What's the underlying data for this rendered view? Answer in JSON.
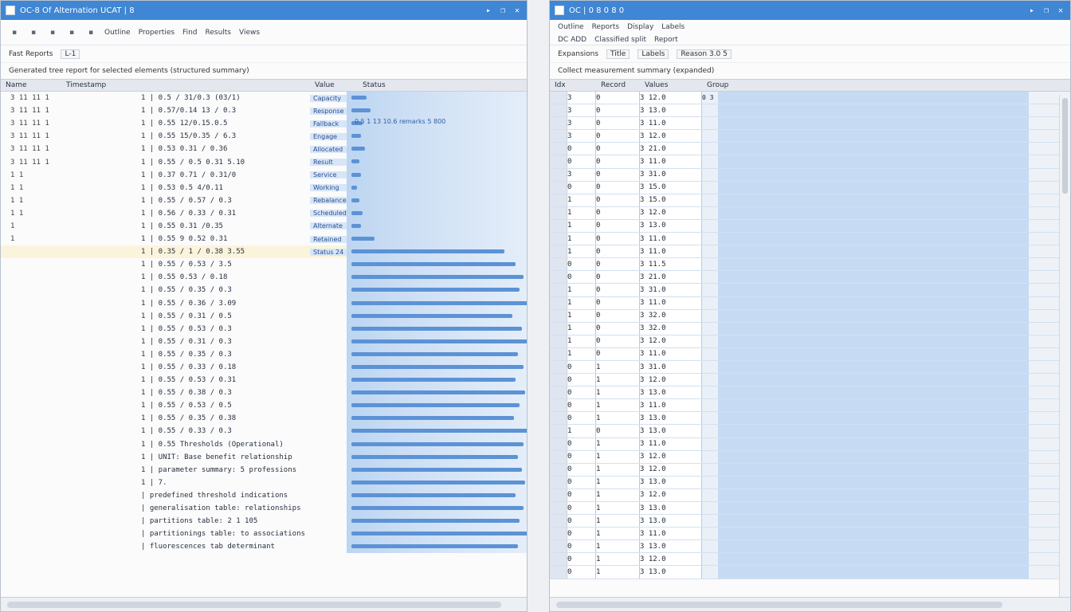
{
  "left": {
    "title": "OC-8 Of Alternation UCAT | 8",
    "toolbar": {
      "items": [
        "Outline",
        "Properties",
        "Find",
        "Results",
        "Views"
      ]
    },
    "path": {
      "label": "Fast Reports",
      "chip": "L-1"
    },
    "status": "Generated tree report for selected elements (structured summary)",
    "headers": [
      "Name",
      "Timestamp",
      "Value",
      "Status"
    ],
    "rows": [
      {
        "a": "3 11 11 1",
        "b": "1 | 0.5 / 31/0.3 (03/1)",
        "c": "Capacity",
        "v": 0.08
      },
      {
        "a": "3 11 11 1",
        "b": "1 | 0.57/0.14 13 / 0.3",
        "c": "Response",
        "v": 0.1
      },
      {
        "a": "3 11 11 1",
        "b": "1 | 0.55 12/0.15.0.5",
        "c": "Fallback",
        "v": 0.06,
        "l": "0.5 1 13 10.6 remarks 5 800"
      },
      {
        "a": "3 11 11 1",
        "b": "1 | 0.55 15/0.35 / 6.3",
        "c": "Engage",
        "v": 0.05
      },
      {
        "a": "3 11 11 1",
        "b": "1 | 0.53 0.31 / 0.36",
        "c": "Allocated",
        "v": 0.07
      },
      {
        "a": "3 11 11 1",
        "b": "1 | 0.55 / 0.5 0.31 5.10",
        "c": "Result",
        "v": 0.04
      },
      {
        "a": "1 1",
        "b": "1 | 0.37 0.71 / 0.31/0",
        "c": "Service",
        "v": 0.05
      },
      {
        "a": "1 1",
        "b": "1 | 0.53 0.5 4/0.11",
        "c": "Working",
        "v": 0.03
      },
      {
        "a": "1 1",
        "b": "1 | 0.55 / 0.57 / 0.3",
        "c": "Rebalance",
        "v": 0.04
      },
      {
        "a": "1 1",
        "b": "1 | 0.56 / 0.33 / 0.31",
        "c": "Scheduled",
        "v": 0.06
      },
      {
        "a": "1",
        "b": "1 | 0.55 0.31 /0.35",
        "c": "Alternate",
        "v": 0.05
      },
      {
        "a": "1",
        "b": "1 | 0.55 9 0.52 0.31",
        "c": "Retained",
        "v": 0.12
      },
      {
        "a": "",
        "b": "1 | 0.35 / 1 / 0.38 3.55",
        "c": "Status 24",
        "v": 0.8,
        "sel": true
      },
      {
        "a": "",
        "b": "1 | 0.55 / 0.53 / 3.5",
        "c": "",
        "v": 0.86
      },
      {
        "a": "",
        "b": "1 | 0.55 0.53 / 0.18",
        "c": "",
        "v": 0.9
      },
      {
        "a": "",
        "b": "1 | 0.55 / 0.35 / 0.3",
        "c": "",
        "v": 0.88
      },
      {
        "a": "",
        "b": "1 | 0.55 / 0.36 / 3.09",
        "c": "",
        "v": 0.92
      },
      {
        "a": "",
        "b": "1 | 0.55 / 0.31 / 0.5",
        "c": "",
        "v": 0.84
      },
      {
        "a": "",
        "b": "1 | 0.55 / 0.53 / 0.3",
        "c": "",
        "v": 0.89
      },
      {
        "a": "",
        "b": "1 | 0.55 / 0.31 / 0.3",
        "c": "",
        "v": 0.93
      },
      {
        "a": "",
        "b": "1 | 0.55 / 0.35 / 0.3",
        "c": "",
        "v": 0.87
      },
      {
        "a": "",
        "b": "1 | 0.55 / 0.33 / 0.18",
        "c": "",
        "v": 0.9
      },
      {
        "a": "",
        "b": "1 | 0.55 / 0.53 / 0.31",
        "c": "",
        "v": 0.86
      },
      {
        "a": "",
        "b": "1 | 0.55 / 0.38 / 0.3",
        "c": "",
        "v": 0.91
      },
      {
        "a": "",
        "b": "1 | 0.55 / 0.53 / 0.5",
        "c": "",
        "v": 0.88
      },
      {
        "a": "",
        "b": "1 | 0.55 / 0.35 / 0.38",
        "c": "",
        "v": 0.85
      },
      {
        "a": "",
        "b": "1 | 0.55 / 0.33 / 0.3",
        "c": "",
        "v": 0.92
      },
      {
        "a": "",
        "b": "1 | 0.55 Thresholds (Operational)",
        "c": "",
        "v": 0.9
      },
      {
        "a": "",
        "b": "1 | UNIT: Base benefit relationship",
        "c": "",
        "v": 0.87
      },
      {
        "a": "",
        "b": "1 | parameter summary: 5 professions",
        "c": "",
        "v": 0.89
      },
      {
        "a": "",
        "b": "1 | 7.",
        "c": "",
        "v": 0.91
      },
      {
        "a": "",
        "b": "| predefined threshold indications",
        "c": "",
        "v": 0.86
      },
      {
        "a": "",
        "b": "| generalisation table: relationships",
        "c": "",
        "v": 0.9
      },
      {
        "a": "",
        "b": "| partitions table: 2 1 105",
        "c": "",
        "v": 0.88
      },
      {
        "a": "",
        "b": "| partitionings table: to associations",
        "c": "",
        "v": 0.92
      },
      {
        "a": "",
        "b": "| fluorescences tab determinant",
        "c": "",
        "v": 0.87
      }
    ]
  },
  "right": {
    "title": "OC | 0 8 0 8 0",
    "toolbar": {
      "items": [
        "Outline",
        "Reports",
        "Display",
        "Labels"
      ]
    },
    "subtoolbar": {
      "items": [
        "DC ADD",
        "Classified split",
        "Report"
      ]
    },
    "path": {
      "label": "Expansions",
      "chips": [
        "Title",
        "Labels",
        "Reason 3.0 5"
      ]
    },
    "status": "Collect measurement summary (expanded)",
    "headers": [
      "Idx",
      "Record",
      "Values",
      "Group"
    ],
    "zoom_value": "0 3",
    "rows": [
      [
        "3",
        "0",
        "3 12.0"
      ],
      [
        "3",
        "0",
        "3 13.0"
      ],
      [
        "3",
        "0",
        "3 11.0"
      ],
      [
        "3",
        "0",
        "3 12.0"
      ],
      [
        "0",
        "0",
        "3 21.0"
      ],
      [
        "0",
        "0",
        "3 11.0"
      ],
      [
        "3",
        "0",
        "3 31.0"
      ],
      [
        "0",
        "0",
        "3 15.0"
      ],
      [
        "1",
        "0",
        "3 15.0"
      ],
      [
        "1",
        "0",
        "3 12.0"
      ],
      [
        "1",
        "0",
        "3 13.0"
      ],
      [
        "1",
        "0",
        "3 11.0"
      ],
      [
        "1",
        "0",
        "3 11.0"
      ],
      [
        "0",
        "0",
        "3 11.5"
      ],
      [
        "0",
        "0",
        "3 21.0"
      ],
      [
        "1",
        "0",
        "3 31.0"
      ],
      [
        "1",
        "0",
        "3 11.0"
      ],
      [
        "1",
        "0",
        "3 32.0"
      ],
      [
        "1",
        "0",
        "3 32.0"
      ],
      [
        "1",
        "0",
        "3 12.0"
      ],
      [
        "1",
        "0",
        "3 11.0"
      ],
      [
        "0",
        "1",
        "3 31.0"
      ],
      [
        "0",
        "1",
        "3 12.0"
      ],
      [
        "0",
        "1",
        "3 13.0"
      ],
      [
        "0",
        "1",
        "3 11.0"
      ],
      [
        "0",
        "1",
        "3 13.0"
      ],
      [
        "1",
        "0",
        "3 13.0"
      ],
      [
        "0",
        "1",
        "3 11.0"
      ],
      [
        "0",
        "1",
        "3 12.0"
      ],
      [
        "0",
        "1",
        "3 12.0"
      ],
      [
        "0",
        "1",
        "3 13.0"
      ],
      [
        "0",
        "1",
        "3 12.0"
      ],
      [
        "0",
        "1",
        "3 13.0"
      ],
      [
        "0",
        "1",
        "3 13.0"
      ],
      [
        "0",
        "1",
        "3 11.0"
      ],
      [
        "0",
        "1",
        "3 13.0"
      ],
      [
        "0",
        "1",
        "3 12.0"
      ],
      [
        "0",
        "1",
        "3 13.0"
      ]
    ]
  }
}
